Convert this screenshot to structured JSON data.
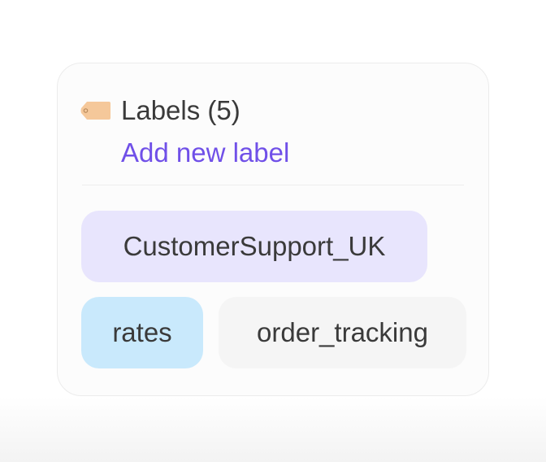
{
  "labels_panel": {
    "title": "Labels (5)",
    "add_label": "Add new label",
    "icon": "tag-icon",
    "chips": [
      {
        "text": "CustomerSupport_UK",
        "color": "#e8e5fd"
      },
      {
        "text": "rates",
        "color": "#c9e9fc"
      },
      {
        "text": "order_tracking",
        "color": "#f5f5f5"
      }
    ],
    "colors": {
      "accent": "#7050e8",
      "tag_icon": "#f5c89a"
    }
  }
}
